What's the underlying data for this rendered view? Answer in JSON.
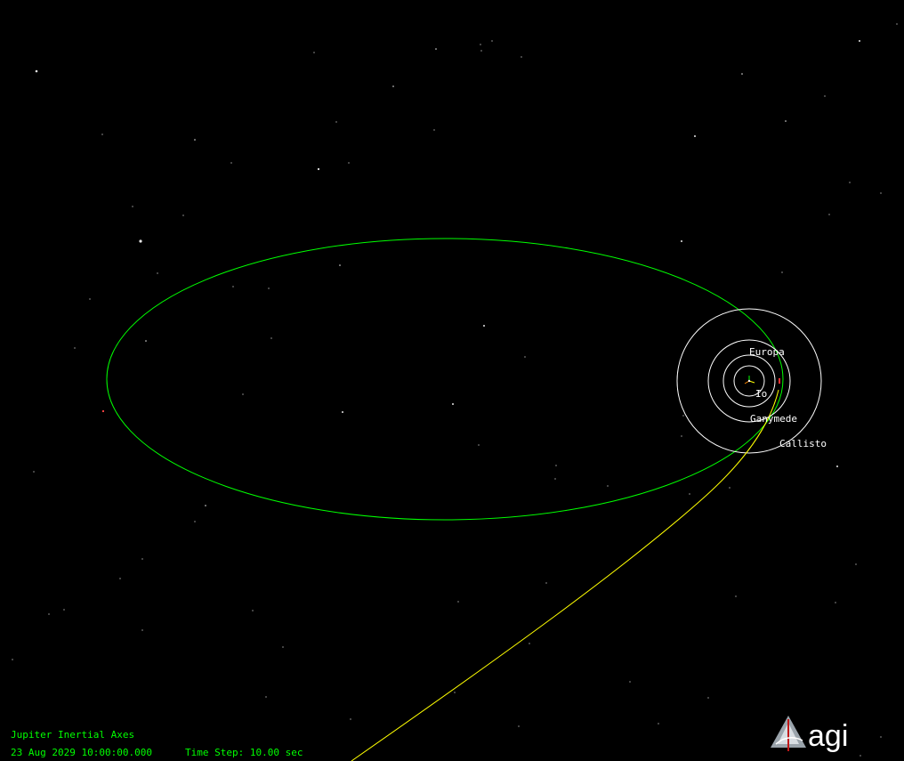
{
  "scene": {
    "moons": [
      {
        "name": "Io",
        "label": "Io"
      },
      {
        "name": "Europa",
        "label": "Europa"
      },
      {
        "name": "Ganymede",
        "label": "Ganymede"
      },
      {
        "name": "Callisto",
        "label": "Callisto"
      }
    ],
    "orbit_colors": {
      "moons": "#ffffff",
      "spacecraft_orbit": "#00ff00",
      "approach_trajectory": "#ffff00",
      "background": "#000000"
    }
  },
  "hud": {
    "frame_label": "Jupiter Inertial Axes",
    "datetime": "23 Aug 2029 10:00:00.000",
    "time_step": "Time Step: 10.00 sec",
    "text_color": "#00ff00"
  },
  "logo": {
    "text": "agi",
    "icon": "agi-logo-icon"
  }
}
